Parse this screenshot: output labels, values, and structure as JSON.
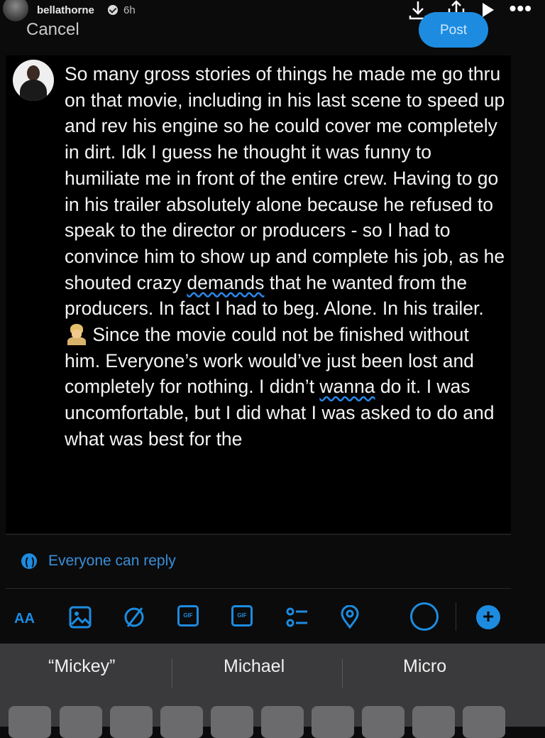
{
  "story": {
    "username": "bellathorne",
    "time": "6h"
  },
  "compose": {
    "cancel_label": "Cancel",
    "post_label": "Post"
  },
  "tweet": {
    "line1": "So many gross stories of things he made me go thru on that movie, including in his last scene to speed up and rev his engine so he could cover me completely in dirt. Idk I guess he thought it was funny to humiliate me in front of the entire crew. Having to go in his trailer absolutely alone because he refused to speak to the director or producers - so I had to convince him to show up and complete his job, as he shouted crazy ",
    "underlined1": "demands",
    "line2": " that he wanted from the producers. In fact I had to beg. Alone. In his trailer. ",
    "line3": " Since the movie could not be finished without him. Everyone’s work would’ve just been lost and completely for nothing. I didn’t ",
    "underlined2": "wanna",
    "line4": " do it. I was uncomfortable, but I did what I was asked to do and what was best for the"
  },
  "reply_setting": "Everyone can reply",
  "toolbar_icons": [
    "text-size-icon",
    "image-icon",
    "gif-circle-icon",
    "gif-icon",
    "poll-icon",
    "list-icon",
    "location-icon",
    "character-progress-icon",
    "add-thread-icon"
  ],
  "toolbar": {
    "aa_label": "AA",
    "gif1": "GIF",
    "gif2": "GIF"
  },
  "keyboard": {
    "suggestions": [
      "“Mickey”",
      "Michael",
      "Micro"
    ]
  },
  "colors": {
    "accent": "#1d8ce0",
    "background": "#000000"
  }
}
